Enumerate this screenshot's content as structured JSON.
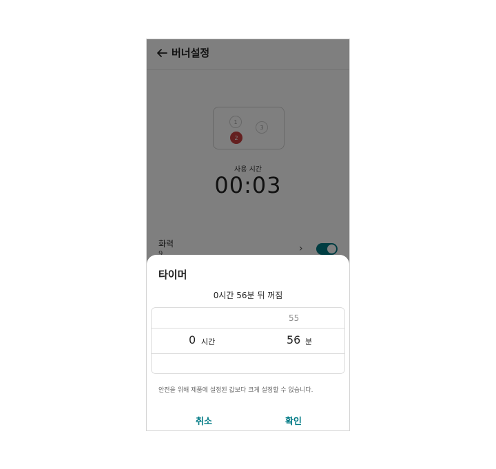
{
  "header": {
    "title": "버너설정",
    "back_icon": "arrow-left-icon"
  },
  "stove": {
    "burners": [
      "1",
      "2",
      "3"
    ],
    "active_burner": "2",
    "active_color": "#c94040"
  },
  "usage": {
    "label": "사용 시간",
    "value": "00:03"
  },
  "power": {
    "label": "화력",
    "sub_value": "9",
    "toggle_on": true,
    "accent_color": "#007a85"
  },
  "timer_sheet": {
    "title": "타이머",
    "summary": "0시간 56분 뒤 꺼짐",
    "picker": {
      "hour_prev": "",
      "hour": "0",
      "hour_unit": "시간",
      "minute_prev": "55",
      "minute": "56",
      "minute_unit": "분"
    },
    "notice": "안전을 위해 제품에 설정된 값보다 크게 설정할 수 없습니다.",
    "cancel_label": "취소",
    "confirm_label": "확인"
  }
}
